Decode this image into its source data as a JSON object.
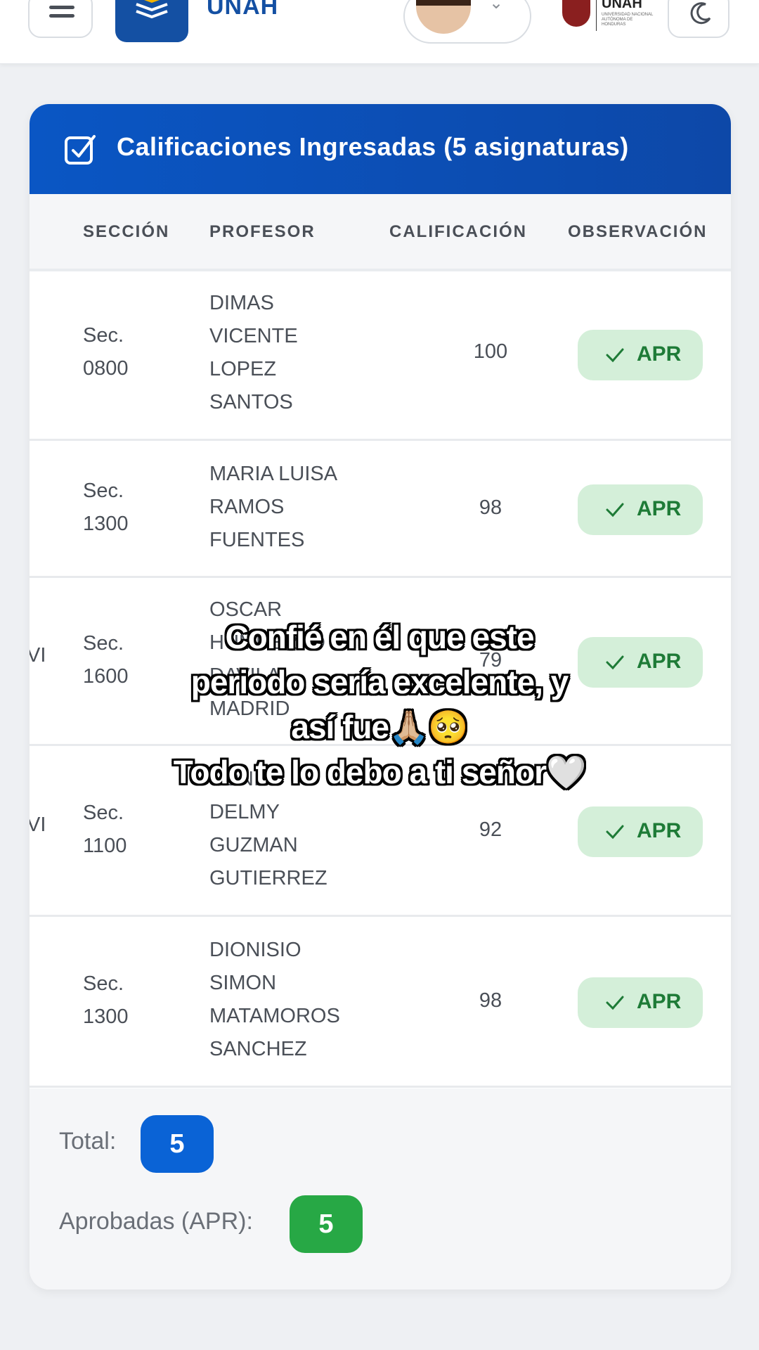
{
  "header": {
    "brand": "UNAH",
    "crest_title": "UNAH",
    "crest_subtitle": "UNIVERSIDAD NACIONAL AUTÓNOMA DE HONDURAS"
  },
  "card": {
    "title": "Calificaciones Ingresadas (5 asignaturas)",
    "columns": [
      "SECCIÓN",
      "PROFESOR",
      "CALIFICACIÓN",
      "OBSERVACIÓN"
    ],
    "rows": [
      {
        "section_1": "Sec.",
        "section_2": "0800",
        "professor": [
          "DIMAS",
          "VICENTE",
          "LOPEZ",
          "SANTOS"
        ],
        "grade": "100",
        "status": "APR"
      },
      {
        "section_1": "Sec.",
        "section_2": "1300",
        "professor": [
          "MARIA LUISA",
          "RAMOS",
          "FUENTES"
        ],
        "grade": "98",
        "status": "APR"
      },
      {
        "section_1": "Sec.",
        "section_2": "1600",
        "cut_prefix": "VI",
        "professor": [
          "OSCAR",
          "HUMBERTO",
          "DAVILA",
          "MADRID"
        ],
        "grade": "79",
        "status": "APR"
      },
      {
        "section_1": "Sec.",
        "section_2": "1100",
        "cut_prefix": "VI",
        "professor": [
          "SONIA",
          "DELMY",
          "GUZMAN",
          "GUTIERREZ"
        ],
        "grade": "92",
        "status": "APR"
      },
      {
        "section_1": "Sec.",
        "section_2": "1300",
        "professor": [
          "DIONISIO",
          "SIMON",
          "MATAMOROS",
          "SANCHEZ"
        ],
        "grade": "98",
        "status": "APR"
      }
    ],
    "footer": {
      "total_label": "Total:",
      "total_value": "5",
      "approved_label": "Aprobadas (APR):",
      "approved_value": "5"
    }
  },
  "caption": {
    "line1": "Confié en él que este",
    "line2": "periodo sería excelente, y",
    "line3": "así fue🙏🏼🥺",
    "line4": "Todo te lo debo a ti señor🤍"
  },
  "colors": {
    "primary": "#0a56c4",
    "success_bg": "#d4efd9",
    "success_text": "#1e7b37",
    "total_pill": "#0a63d6",
    "approved_pill": "#27a845"
  }
}
